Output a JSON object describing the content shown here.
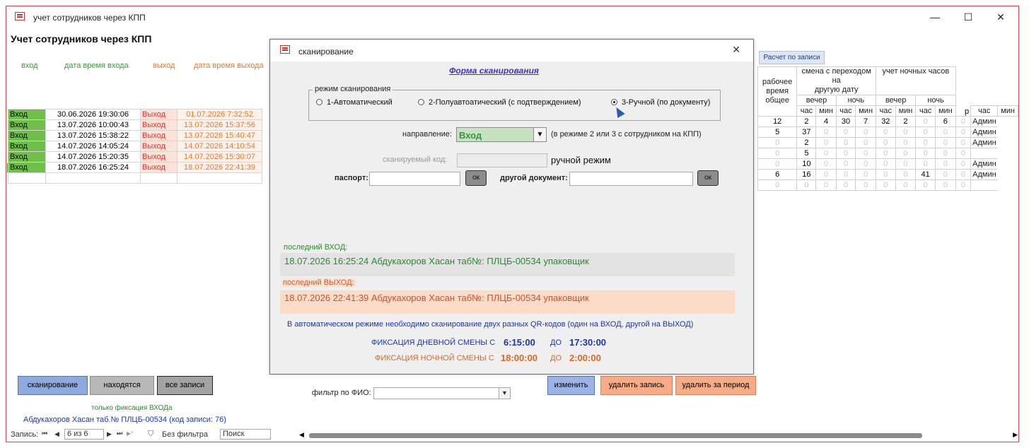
{
  "window": {
    "title": "учет сотрудников через КПП",
    "minimize": "—",
    "maximize": "☐",
    "close": "✕"
  },
  "main": {
    "heading": "Учет сотрудников через КПП",
    "col_in": "вход",
    "col_in_dt": "дата время входа",
    "col_out": "выход",
    "col_out_dt": "дата время выхода",
    "rows": [
      {
        "in": "Вход",
        "in_dt": "30.06.2026 19:30:06",
        "out": "Выход",
        "out_dt": "01.07.2026 7:32:52"
      },
      {
        "in": "Вход",
        "in_dt": "13.07.2026 10:00:43",
        "out": "Выход",
        "out_dt": "13.07.2026 15:37:56"
      },
      {
        "in": "Вход",
        "in_dt": "13.07.2026 15:38:22",
        "out": "Выход",
        "out_dt": "13.07.2026 15:40:47"
      },
      {
        "in": "Вход",
        "in_dt": "14.07.2026 14:05:24",
        "out": "Выход",
        "out_dt": "14.07.2026 14:10:54"
      },
      {
        "in": "Вход",
        "in_dt": "14.07.2026 15:20:35",
        "out": "Выход",
        "out_dt": "14.07.2026 15:30:07"
      },
      {
        "in": "Вход",
        "in_dt": "18.07.2026 16:25:24",
        "out": "Выход",
        "out_dt": "18.07.2026 22:41:39"
      }
    ]
  },
  "right": {
    "calc_button": "Расчет по записи",
    "hdr_work_1": "рабочее",
    "hdr_work_2": "время",
    "hdr_work_3": "общее",
    "hdr_shift_1": "смена с переходом на",
    "hdr_shift_2": "другую дату",
    "hdr_night_1": "учет ночных часов",
    "hdr_evening": "вечер",
    "hdr_night": "ночь",
    "hdr_p": "р",
    "hdr_hour": "час",
    "hdr_min": "мин",
    "rows": [
      [
        "12",
        "2",
        "4",
        "30",
        "7",
        "32",
        "2",
        "0",
        "6",
        "0",
        "Админ"
      ],
      [
        "5",
        "37",
        "0",
        "0",
        "0",
        "0",
        "0",
        "0",
        "0",
        "0",
        "Админ"
      ],
      [
        "0",
        "2",
        "0",
        "0",
        "0",
        "0",
        "0",
        "0",
        "0",
        "0",
        "Админ"
      ],
      [
        "0",
        "5",
        "0",
        "0",
        "0",
        "0",
        "0",
        "0",
        "0",
        "0",
        ""
      ],
      [
        "0",
        "10",
        "0",
        "0",
        "0",
        "0",
        "0",
        "0",
        "0",
        "0",
        "Админ"
      ],
      [
        "6",
        "16",
        "0",
        "0",
        "0",
        "0",
        "0",
        "41",
        "0",
        "0",
        "Админ"
      ],
      [
        "0",
        "0",
        "0",
        "0",
        "0",
        "0",
        "0",
        "0",
        "0",
        "0",
        ""
      ]
    ]
  },
  "bottom": {
    "scan_button": "сканирование",
    "present_button": "находятся",
    "all_button": "все записи",
    "hint": "только фиксация ВХОДа",
    "filter_label": "фильтр по ФИО:",
    "edit_button": "изменить",
    "delete_button": "удалить запись",
    "delete_period_button": "удалить за период",
    "status": "Абдукахоров Хасан  таб.№ ПЛЦБ-00534  (код записи: 76)",
    "nav_label": "Запись:",
    "nav_first": "⏮",
    "nav_prev": "◀",
    "nav_value": "6 из 6",
    "nav_next": "▶",
    "nav_last": "⏭",
    "nav_new": "▶*",
    "no_filter": "Без фильтра",
    "search_placeholder": "Поиск"
  },
  "dialog": {
    "title": "сканирование",
    "close": "✕",
    "form_link": "Форма сканирования",
    "mode_legend": "режим сканирования",
    "mode_1": "1-Автоматический",
    "mode_2": "2-Полуавтоатический (с подтверждением)",
    "mode_3": "3-Ручной (по документу)",
    "direction_label": "направление:",
    "direction_value": "Вход",
    "direction_note": "(в режиме 2 или 3 с сотрудником на КПП)",
    "code_label": "сканируемый код:",
    "manual_label": "ручной режим",
    "passport_label": "паспорт:",
    "ok": "ок",
    "other_doc_label": "другой документ:",
    "last_in_label": "последний ВХОД:",
    "last_in_text": "18.07.2026 16:25:24 Абдукахоров Хасан  таб№: ПЛЦБ-00534 упаковщик",
    "last_out_label": "последний ВЫХОД:",
    "last_out_text": "18.07.2026 22:41:39 Абдукахоров Хасан  таб№: ПЛЦБ-00534 упаковщик",
    "auto_note": "В автоматическом режиме необходимо сканирование двух разных QR-кодов (один на ВХОД, другой на ВЫХОД)",
    "day_label": "ФИКСАЦИЯ ДНЕВНОЙ СМЕНЫ С",
    "day_from": "6:15:00",
    "do_label": "ДО",
    "day_to": "17:30:00",
    "night_label": "ФИКСАЦИЯ НОЧНОЙ СМЕНЫ С",
    "night_from": "18:00:00",
    "night_to": "2:00:00",
    "colors": {
      "day": "#1b37a6",
      "night": "#d46a24"
    }
  }
}
